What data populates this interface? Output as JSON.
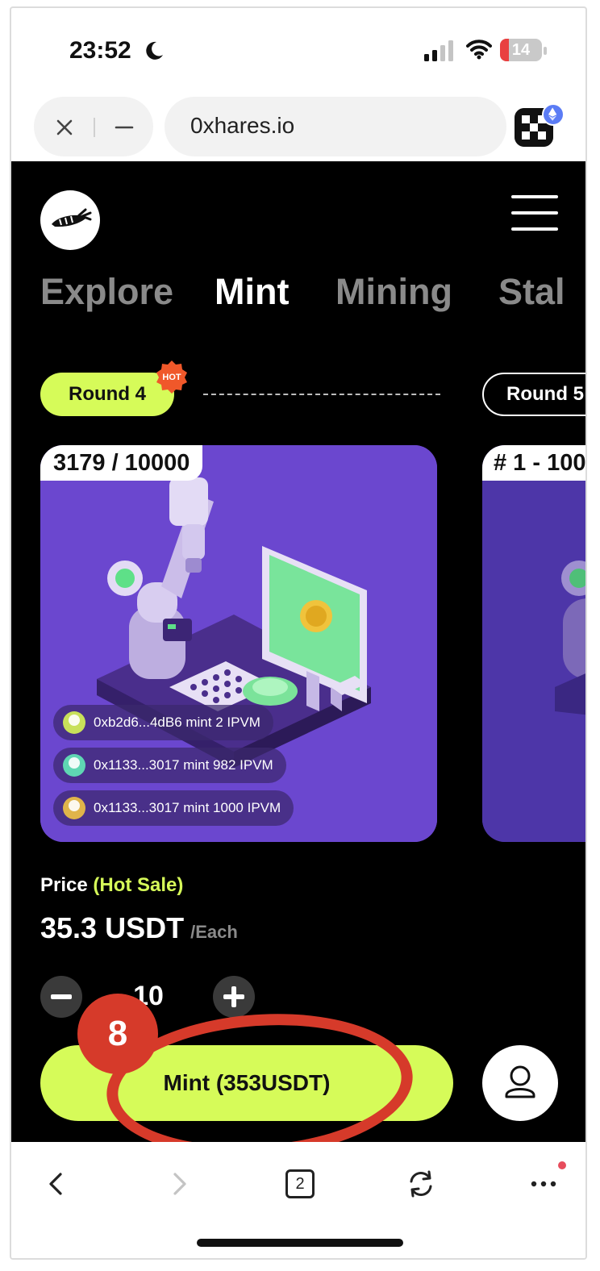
{
  "status_bar": {
    "time": "23:52",
    "battery": "14"
  },
  "browser": {
    "url": "0xhares.io"
  },
  "nav": {
    "tabs": [
      {
        "label": "Explore",
        "active": false
      },
      {
        "label": "Mint",
        "active": true
      },
      {
        "label": "Mining",
        "active": false
      },
      {
        "label": "Stal",
        "active": false
      }
    ]
  },
  "rounds": {
    "current_label": "Round 4",
    "hot_badge": "HOT",
    "next_label": "Round 5"
  },
  "card": {
    "counter": "3179 / 10000",
    "next_counter": "# 1 - 100",
    "activity": [
      {
        "text": "0xb2d6...4dB6 mint 2 IPVM",
        "avatar_color": "#c8e05a"
      },
      {
        "text": "0x1133...3017 mint 982 IPVM",
        "avatar_color": "#5fd6b3"
      },
      {
        "text": "0x1133...3017 mint 1000 IPVM",
        "avatar_color": "#e0b44a"
      }
    ]
  },
  "price": {
    "label": "Price",
    "tag": "(Hot Sale)",
    "value": "35.3 USDT",
    "unit": "/Each"
  },
  "quantity": {
    "value": "10"
  },
  "mint_button": {
    "label": "Mint (353USDT)"
  },
  "annotation": {
    "number": "8"
  },
  "toolbar": {
    "tab_count": "2"
  },
  "colors": {
    "accent": "#d6fb59",
    "card_purple": "#6b47cf",
    "annotation_red": "#d63a2a",
    "hot_orange": "#f0582a"
  }
}
